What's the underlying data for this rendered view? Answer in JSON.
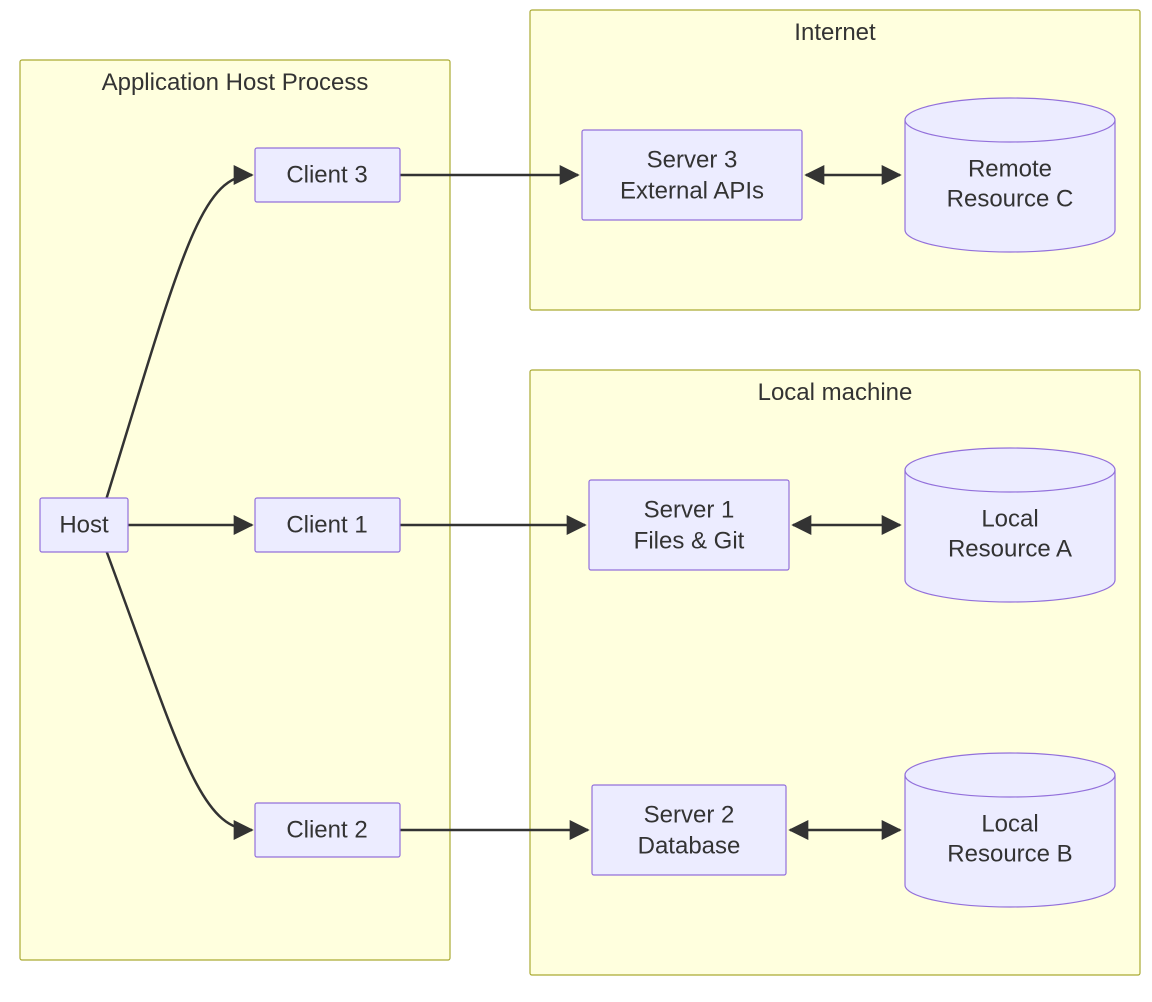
{
  "groups": {
    "app_host": {
      "title": "Application Host Process"
    },
    "internet": {
      "title": "Internet"
    },
    "local": {
      "title": "Local machine"
    }
  },
  "nodes": {
    "host": {
      "label": "Host"
    },
    "client1": {
      "label": "Client 1"
    },
    "client2": {
      "label": "Client 2"
    },
    "client3": {
      "label": "Client 3"
    },
    "server1": {
      "line1": "Server 1",
      "line2": "Files & Git"
    },
    "server2": {
      "line1": "Server 2",
      "line2": "Database"
    },
    "server3": {
      "line1": "Server 3",
      "line2": "External APIs"
    },
    "resA": {
      "line1": "Local",
      "line2": "Resource A"
    },
    "resB": {
      "line1": "Local",
      "line2": "Resource B"
    },
    "resC": {
      "line1": "Remote",
      "line2": "Resource C"
    }
  },
  "edges": [
    {
      "from": "host",
      "to": "client1",
      "bidir": false
    },
    {
      "from": "host",
      "to": "client2",
      "bidir": false
    },
    {
      "from": "host",
      "to": "client3",
      "bidir": false
    },
    {
      "from": "client1",
      "to": "server1",
      "bidir": false
    },
    {
      "from": "client2",
      "to": "server2",
      "bidir": false
    },
    {
      "from": "client3",
      "to": "server3",
      "bidir": false
    },
    {
      "from": "server1",
      "to": "resA",
      "bidir": true
    },
    {
      "from": "server2",
      "to": "resB",
      "bidir": true
    },
    {
      "from": "server3",
      "to": "resC",
      "bidir": true
    }
  ],
  "colors": {
    "group_fill": "#ffffde",
    "group_stroke": "#aaaa33",
    "node_fill": "#ececff",
    "node_stroke": "#9370db",
    "edge": "#333333"
  }
}
